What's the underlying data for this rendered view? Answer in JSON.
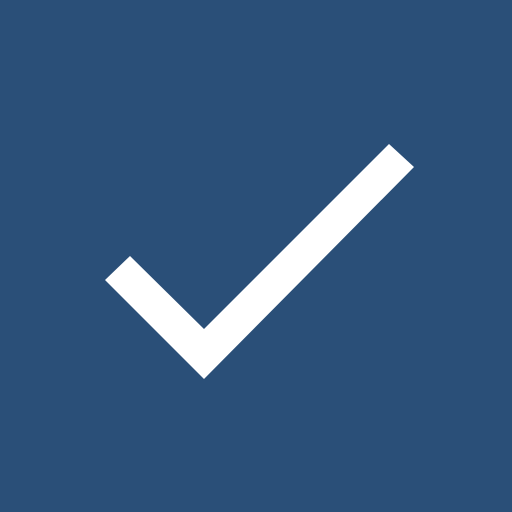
{
  "icon": {
    "name": "checkmark-icon",
    "background_color": "#2a4f78",
    "glyph_color": "#ffffff"
  }
}
